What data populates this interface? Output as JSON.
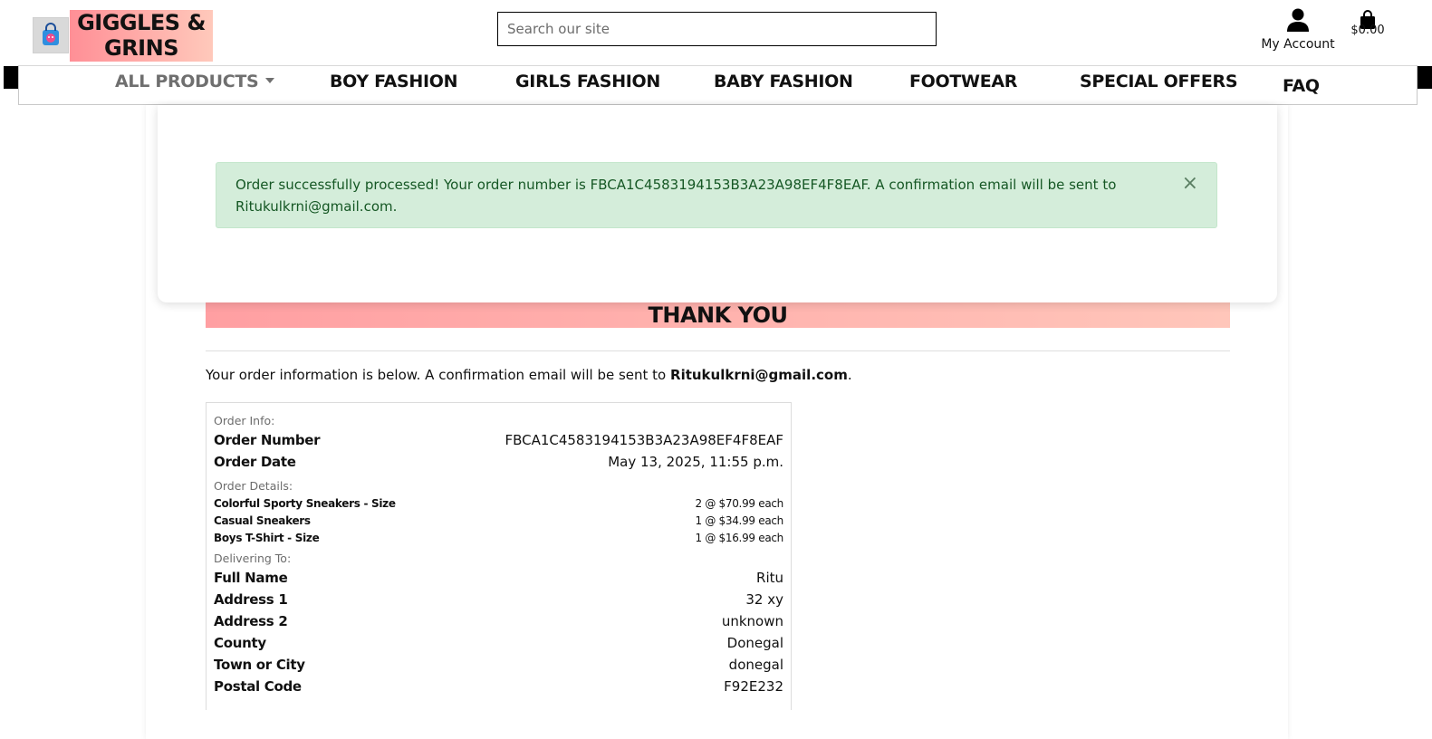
{
  "header": {
    "brand": "GIGGLES & GRINS",
    "search_placeholder": "Search our site",
    "account_label": "My Account",
    "cart_total": "$0.00"
  },
  "nav": {
    "items": [
      {
        "label": "ALL PRODUCTS"
      },
      {
        "label": "BOY FASHION"
      },
      {
        "label": "GIRLS FASHION"
      },
      {
        "label": "BABY FASHION"
      },
      {
        "label": "FOOTWEAR"
      },
      {
        "label": "SPECIAL OFFERS"
      },
      {
        "label": "FAQ"
      }
    ]
  },
  "alert": {
    "message": "Order successfully processed! Your order number is FBCA1C4583194153B3A23A98EF4F8EAF. A confirmation email will be sent to Ritukulkrni@gmail.com.",
    "close": "×"
  },
  "main": {
    "heading": "THANK YOU",
    "intro_text": "Your order information is below. A confirmation email will be sent to ",
    "intro_email": "Ritukulkrni@gmail.com",
    "intro_end": "."
  },
  "order": {
    "info_label": "Order Info:",
    "number_label": "Order Number",
    "number_value": "FBCA1C4583194153B3A23A98EF4F8EAF",
    "date_label": "Order Date",
    "date_value": "May 13, 2025, 11:55 p.m.",
    "details_label": "Order Details:",
    "items": [
      {
        "name": "Colorful Sporty Sneakers - Size",
        "qty": "2 @ $70.99 each"
      },
      {
        "name": "Casual Sneakers",
        "qty": "1 @ $34.99 each"
      },
      {
        "name": "Boys T-Shirt - Size",
        "qty": "1 @ $16.99 each"
      }
    ],
    "delivering_label": "Delivering To:",
    "delivery": [
      {
        "label": "Full Name",
        "value": "Ritu"
      },
      {
        "label": "Address 1",
        "value": "32 xy"
      },
      {
        "label": "Address 2",
        "value": "unknown"
      },
      {
        "label": "County",
        "value": "Donegal"
      },
      {
        "label": "Town or City",
        "value": "donegal"
      },
      {
        "label": "Postal Code",
        "value": "F92E232"
      }
    ]
  }
}
